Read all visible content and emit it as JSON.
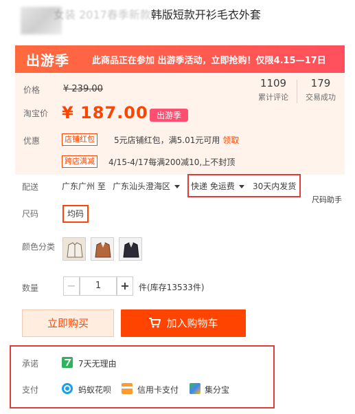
{
  "header": {
    "title_visible": "韩版短款开衫毛衣外套",
    "title_faded": "女装 2017春季新款"
  },
  "promo": {
    "badge": "出游季",
    "text": "此商品正在参加 出游季活动，立即抢购！仅限4.15—17日"
  },
  "price": {
    "orig_label": "价格",
    "orig_value": "¥ 239.00",
    "tb_label": "淘宝价",
    "tb_value": "¥ 187.00",
    "tag": "出游季",
    "stats": [
      {
        "num": "1109",
        "cap": "累计评论"
      },
      {
        "num": "179",
        "cap": "交易成功"
      }
    ]
  },
  "coupon": {
    "label": "优惠",
    "tag1": "店铺红包",
    "text1": "5元店铺红包，满5.01元可用",
    "link1": "领取",
    "tag2": "跨店满减",
    "text2": "4/15-4/17每满200减10,上不封顶"
  },
  "shipping": {
    "label": "配送",
    "from": "广东广州 至",
    "to": "广东汕头澄海区",
    "method": "快递 免运费",
    "time": "30天内发货"
  },
  "size": {
    "label": "尺码",
    "option": "均码",
    "help": "尺码助手"
  },
  "color": {
    "label": "颜色分类",
    "items": [
      "cream-jacket",
      "brown-jacket",
      "black-jacket"
    ]
  },
  "quantity": {
    "label": "数量",
    "minus": "−",
    "value": "1",
    "plus": "+",
    "stock": "件(库存13533件)"
  },
  "actions": {
    "buy": "立即购买",
    "cart": "加入购物车"
  },
  "service": {
    "promise_label": "承诺",
    "promise_text": "7天无理由",
    "pay_label": "支付",
    "pay_methods": [
      "蚂蚁花呗",
      "信用卡支付",
      "集分宝"
    ]
  },
  "colors": {
    "accent": "#ff4400",
    "promo_start": "#ff6a3d",
    "promo_end": "#ff4f5e",
    "highlight_box": "#e03b3b"
  }
}
